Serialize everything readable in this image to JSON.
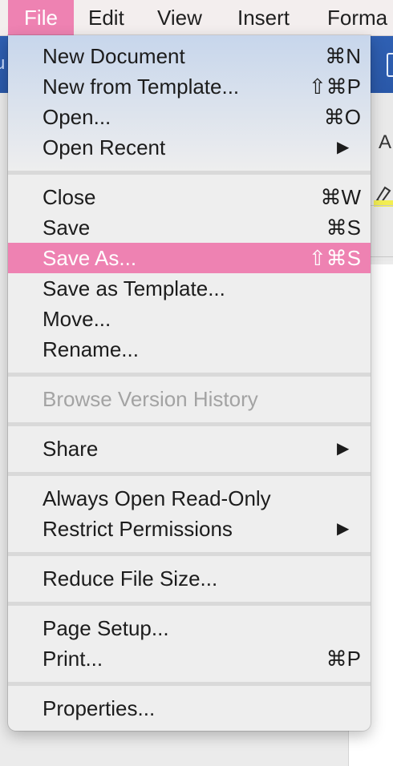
{
  "menubar": {
    "items": [
      {
        "label": "File",
        "active": true
      },
      {
        "label": "Edit"
      },
      {
        "label": "View"
      },
      {
        "label": "Insert"
      },
      {
        "label": "Forma"
      }
    ]
  },
  "background": {
    "left_ribbon_fragment": "u",
    "toolbar_letter": "A"
  },
  "menu": {
    "groups": [
      [
        {
          "label": "New Document",
          "shortcut": "⌘N"
        },
        {
          "label": "New from Template...",
          "shortcut": "⇧⌘P"
        },
        {
          "label": "Open...",
          "shortcut": "⌘O"
        },
        {
          "label": "Open Recent",
          "submenu": true
        }
      ],
      [
        {
          "label": "Close",
          "shortcut": "⌘W"
        },
        {
          "label": "Save",
          "shortcut": "⌘S"
        },
        {
          "label": "Save As...",
          "shortcut": "⇧⌘S",
          "highlighted": true
        },
        {
          "label": "Save as Template..."
        },
        {
          "label": "Move..."
        },
        {
          "label": "Rename..."
        }
      ],
      [
        {
          "label": "Browse Version History",
          "disabled": true
        }
      ],
      [
        {
          "label": "Share",
          "submenu": true
        }
      ],
      [
        {
          "label": "Always Open Read-Only"
        },
        {
          "label": "Restrict Permissions",
          "submenu": true
        }
      ],
      [
        {
          "label": "Reduce File Size..."
        }
      ],
      [
        {
          "label": "Page Setup..."
        },
        {
          "label": "Print...",
          "shortcut": "⌘P"
        }
      ],
      [
        {
          "label": "Properties..."
        }
      ]
    ],
    "submenu_arrow": "▶"
  },
  "colors": {
    "highlight": "#ee82b2",
    "menu_bg": "#eeeeee",
    "disabled_text": "#a3a3a3",
    "ribbon_blue": "#2f60b3"
  }
}
